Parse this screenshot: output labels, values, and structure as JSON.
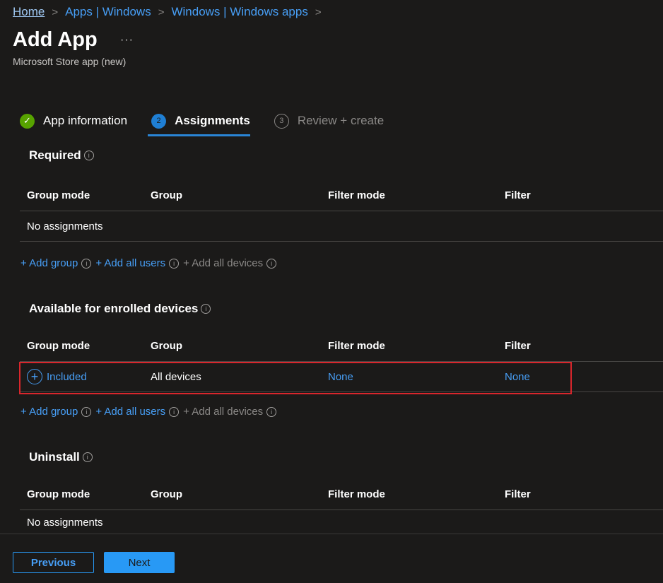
{
  "breadcrumb": {
    "items": [
      "Home",
      "Apps | Windows",
      "Windows | Windows apps"
    ]
  },
  "header": {
    "title": "Add App",
    "more_label": "···",
    "subtitle": "Microsoft Store app (new)"
  },
  "steps": [
    {
      "number": "✓",
      "label": "App information",
      "state": "done"
    },
    {
      "number": "2",
      "label": "Assignments",
      "state": "active"
    },
    {
      "number": "3",
      "label": "Review + create",
      "state": "pending"
    }
  ],
  "columns": [
    "Group mode",
    "Group",
    "Filter mode",
    "Filter"
  ],
  "sections": {
    "required": {
      "title": "Required",
      "empty_text": "No assignments"
    },
    "available": {
      "title": "Available for enrolled devices",
      "row": {
        "group_mode": "Included",
        "group": "All devices",
        "filter_mode": "None",
        "filter": "None"
      }
    },
    "uninstall": {
      "title": "Uninstall",
      "empty_text": "No assignments"
    }
  },
  "add_links": {
    "add_group": "+ Add group",
    "add_all_users": "+ Add all users",
    "add_all_devices": "+ Add all devices"
  },
  "icons": {
    "info": "i",
    "plus": "+"
  },
  "footer": {
    "previous_label": "Previous",
    "next_label": "Next"
  },
  "colors": {
    "accent": "#479ef5",
    "primary_button": "#2899f5",
    "success": "#57a300",
    "highlight_box": "#d9262c",
    "background": "#1b1a19"
  }
}
